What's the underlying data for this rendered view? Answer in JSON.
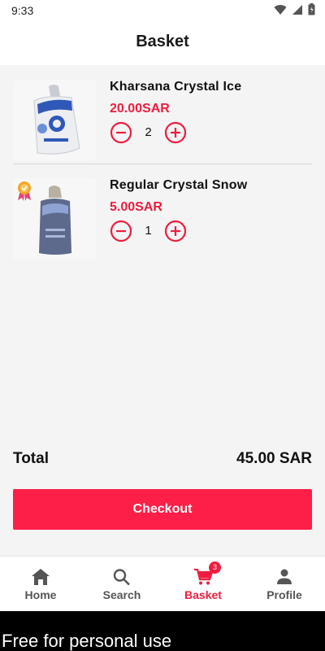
{
  "status_bar": {
    "time": "9:33",
    "icons": [
      "wifi-icon",
      "signal-icon",
      "battery-icon"
    ]
  },
  "header": {
    "title": "Basket"
  },
  "items": [
    {
      "name": "Kharsana Crystal Ice",
      "price": "20.00SAR",
      "quantity": "2",
      "image_icon": "ice-bag-image"
    },
    {
      "name": "Regular Crystal Snow",
      "price": "5.00SAR",
      "quantity": "1",
      "image_icon": "snow-bag-image",
      "badge_icon": "award-ribbon-icon"
    }
  ],
  "summary": {
    "total_label": "Total",
    "total_value": "45.00 SAR"
  },
  "checkout": {
    "label": "Checkout"
  },
  "nav": {
    "items": [
      {
        "label": "Home",
        "icon": "home-icon"
      },
      {
        "label": "Search",
        "icon": "search-icon"
      },
      {
        "label": "Basket",
        "icon": "cart-icon",
        "badge": "3",
        "active": true
      },
      {
        "label": "Profile",
        "icon": "profile-icon"
      }
    ]
  },
  "watermark": {
    "text": "Free for personal use"
  },
  "colors": {
    "accent": "#ee1d3f",
    "checkout_bg": "#fd1f48",
    "content_bg": "#f4f4f4"
  }
}
